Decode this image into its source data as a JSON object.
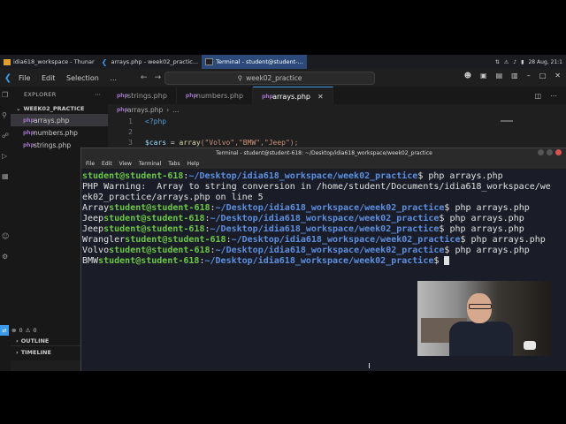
{
  "taskbar": {
    "tasks": [
      {
        "label": "idia618_workspace - Thunar"
      },
      {
        "label": "arrays.php - week02_practic..."
      },
      {
        "label": "Terminal - student@student-..."
      }
    ],
    "clock": "28 Aug, 21:1"
  },
  "vscode": {
    "menu": [
      "File",
      "Edit",
      "Selection",
      "..."
    ],
    "command_center": "week02_practice",
    "explorer": {
      "header": "EXPLORER",
      "folder": "WEEK02_PRACTICE",
      "files": [
        "arrays.php",
        "numbers.php",
        "strings.php"
      ],
      "outline": "OUTLINE",
      "timeline": "TIMELINE"
    },
    "tabs": [
      {
        "label": "strings.php"
      },
      {
        "label": "numbers.php"
      },
      {
        "label": "arrays.php"
      }
    ],
    "breadcrumb": {
      "file": "arrays.php",
      "more": "..."
    },
    "code": [
      {
        "num": "1",
        "text": "<?php"
      },
      {
        "num": "2",
        "text": ""
      },
      {
        "num": "3",
        "var": "$cars",
        "eq": " = ",
        "fn": "array",
        "rest": "(\"Volvo\",\"BMW\",\"Jeep\");"
      }
    ],
    "status": {
      "errors": "0",
      "warnings": "0"
    }
  },
  "terminal": {
    "title": "Terminal - student@student-618: ~/Desktop/idia618_workspace/week02_practice",
    "menu": [
      "File",
      "Edit",
      "View",
      "Terminal",
      "Tabs",
      "Help"
    ],
    "lines": [
      {
        "pre": "",
        "user": "student@student-618",
        "path": "~/Desktop/idia618_workspace/week02_practice",
        "cmd": "$ php arrays.php"
      },
      {
        "text": "PHP Warning:  Array to string conversion in /home/student/Documents/idia618_workspace/we"
      },
      {
        "text": "ek02_practice/arrays.php on line 5"
      },
      {
        "pre": "Array",
        "user": "student@student-618",
        "path": "~/Desktop/idia618_workspace/week02_practice",
        "cmd": "$ php arrays.php"
      },
      {
        "pre": "Jeep",
        "user": "student@student-618",
        "path": "~/Desktop/idia618_workspace/week02_practice",
        "cmd": "$ php arrays.php"
      },
      {
        "pre": "Jeep",
        "user": "student@student-618",
        "path": "~/Desktop/idia618_workspace/week02_practice",
        "cmd": "$ php arrays.php"
      },
      {
        "pre": "Wrangler",
        "user": "student@student-618",
        "path": "~/Desktop/idia618_workspace/week02_practice",
        "cmd": "$ php arrays.php"
      },
      {
        "pre": "Volvo",
        "user": "student@student-618",
        "path": "~/Desktop/idia618_workspace/week02_practice",
        "cmd": "$ php arrays.php"
      },
      {
        "pre": "BMW",
        "user": "student@student-618",
        "path": "~/Desktop/idia618_workspace/week02_practice",
        "cmd": "$ "
      }
    ]
  }
}
